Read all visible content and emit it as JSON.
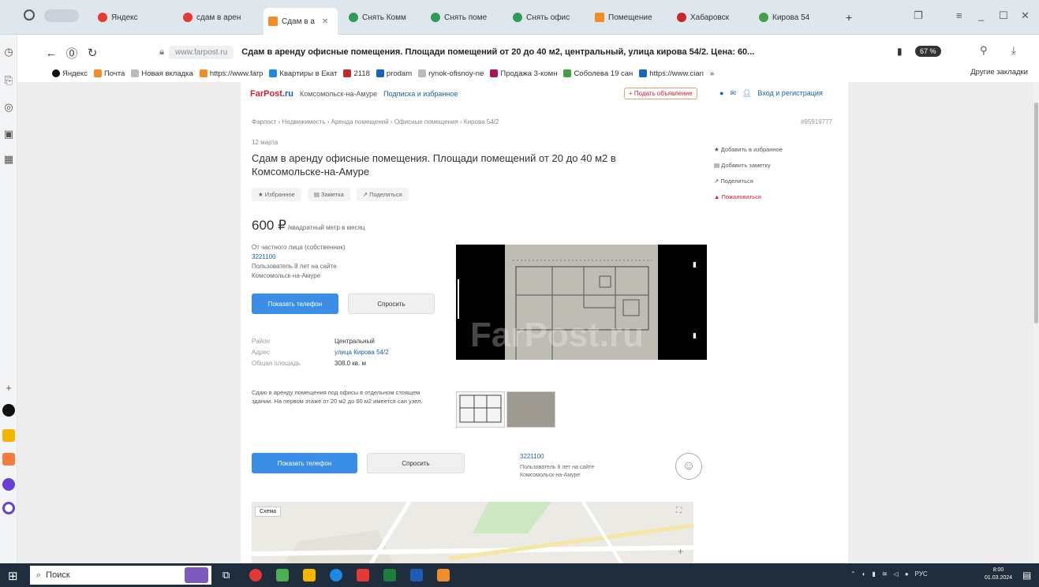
{
  "browser": {
    "tabs": [
      {
        "label": "Яндекс",
        "color": "#e53935",
        "active": false
      },
      {
        "label": "сдам в арен",
        "color": "#e53935",
        "active": false
      },
      {
        "label": "Сдам в а",
        "color": "#f28c28",
        "active": true
      },
      {
        "label": "Снять Комм",
        "color": "#2e9b5a",
        "active": false
      },
      {
        "label": "Снять поме",
        "color": "#2e9b5a",
        "active": false
      },
      {
        "label": "Снять офис",
        "color": "#2e9b5a",
        "active": false
      },
      {
        "label": "Помещение",
        "color": "#f28c28",
        "active": false
      },
      {
        "label": "Хабаровск",
        "color": "#c62828",
        "active": false
      },
      {
        "label": "Кирова 54",
        "color": "#43a047",
        "active": false
      }
    ],
    "new_tab": "+",
    "url_domain": "www.farpost.ru",
    "url_title": "Сдам в аренду офисные помещения. Площади помещений от 20 до 40 м2, центральный, улица кирова 54/2. Цена: 60...",
    "zoom": "67 %",
    "bookmarks": [
      {
        "label": "Яндекс",
        "color": "#111"
      },
      {
        "label": "Почта",
        "color": "#f28c28"
      },
      {
        "label": "Новая вкладка",
        "color": "#888"
      },
      {
        "label": "https://www.farp",
        "color": "#f28c28"
      },
      {
        "label": "Квартиры в Екат",
        "color": "#1e88e5"
      },
      {
        "label": "2118",
        "color": "#c62828"
      },
      {
        "label": "prodam",
        "color": "#1565c0"
      },
      {
        "label": "rynok-ofisnoy-ne",
        "color": "#888"
      },
      {
        "label": "Продажа 3-комн",
        "color": "#ad1457"
      },
      {
        "label": "Соболева 19 сан",
        "color": "#43a047"
      },
      {
        "label": "https://www.cian",
        "color": "#1565c0"
      }
    ],
    "bookmarks_more": "»",
    "bookmarks_other": "Другие закладки"
  },
  "site": {
    "logo_main": "FarPost",
    "logo_tld": ".ru",
    "city": "Комсомольск-на-Амуре",
    "subscribe": "Подписка и избранное",
    "post_ad": "+ Подать объявление",
    "login": "Вход и регистрация"
  },
  "ad": {
    "breadcrumb": "Фарпост › Недвижимость › Аренда помещений › Офисные помещения › Кирова 54/2",
    "id": "#95919777",
    "date": "12 марта",
    "title": "Сдам в аренду офисные помещения. Площади помещений от 20 до 40 м2 в Комсомольске-на-Амуре",
    "actions": [
      "★ Избранное",
      "▤ Заметка",
      "↗ Поделиться"
    ],
    "price": "600 ₽",
    "price_note": "/квадратный метр в месяц",
    "seller_label": "От частного лица (собственник)",
    "seller_id": "3221100",
    "seller_since": "Пользователь 8 лет на сайте",
    "seller_city": "Комсомольск-на-Амуре",
    "show_phone": "Показать телефон",
    "ask": "Спросить",
    "props": [
      {
        "k": "Район",
        "v": "Центральный",
        "link": false
      },
      {
        "k": "Адрес",
        "v": "улица Кирова 54/2",
        "link": true
      },
      {
        "k": "Общая площадь",
        "v": "308.0 кв. м",
        "link": false
      }
    ],
    "description": "Сдаю в аренду помещения под офисы в отдельном стоящем здании. На первом этаже от 20 м2 до 60 м2 имеется сан узел.",
    "watermark": "FarPost.ru",
    "right_menu": [
      "★ Добавить в избранное",
      "▤ Добавить заметку",
      "↗ Поделиться"
    ],
    "complain": "▲ Пожаловаться",
    "map_scheme": "Схема"
  },
  "taskbar": {
    "search_placeholder": "Поиск",
    "tray_lang": "РУС",
    "time": "8:00",
    "date": "01.03.2024"
  }
}
